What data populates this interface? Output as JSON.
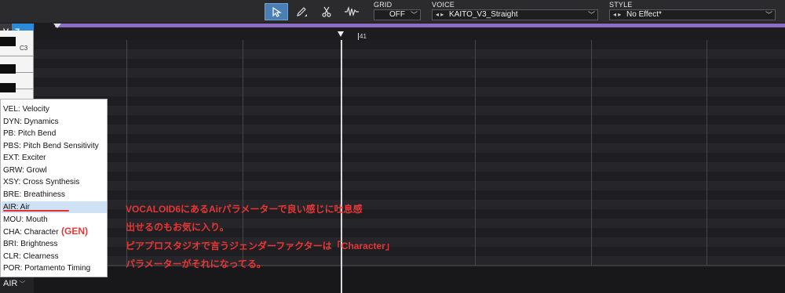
{
  "toolbar": {
    "grid_label": "GRID",
    "grid_value": "OFF",
    "voice_label": "VOICE",
    "voice_value": "KAITO_V3_Straight",
    "style_label": "STYLE",
    "style_value": "No Effect*",
    "nav_arrows": "◂ ▸",
    "tools": [
      "pointer-tool-icon",
      "pencil-tool-icon",
      "scissors-tool-icon",
      "waveform-tool-icon"
    ]
  },
  "track": {
    "v_label": "V",
    "number": "7"
  },
  "ruler": {
    "bar_number": "41"
  },
  "keyboard": {
    "c3_label": "C3"
  },
  "dropdown": {
    "items": [
      "VEL: Velocity",
      "DYN: Dynamics",
      "PB: Pitch Bend",
      "PBS: Pitch Bend Sensitivity",
      "EXT: Exciter",
      "GRW: Growl",
      "XSY: Cross Synthesis",
      "BRE: Breathiness",
      "AIR: Air",
      "MOU: Mouth",
      "CHA: Character",
      "BRI: Brightness",
      "CLR: Clearness",
      "POR: Portamento Timing"
    ],
    "selected": "AIR: Air",
    "gen_tag": "(GEN)"
  },
  "control": {
    "current": "AIR"
  },
  "annotation": {
    "lines": [
      "VOCALOID6にあるAirパラメーターで良い感じに吐息感",
      "出せるのもお気に入り。",
      "ピアプロスタジオで言うジェンダーファクターは「Character」",
      "パラメーターがそれになってる。"
    ]
  },
  "colors": {
    "accent_blue": "#2b8bd6",
    "ruler_purple": "#8c6cc4",
    "annotation_red": "#e83535",
    "selected_item": "#cfe2f5"
  }
}
